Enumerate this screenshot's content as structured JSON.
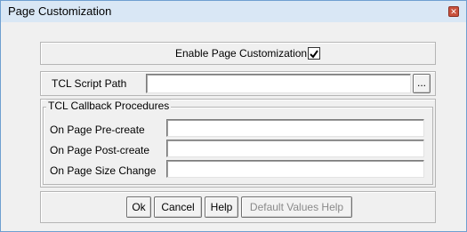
{
  "window": {
    "title": "Page Customization",
    "close_icon": "close-icon"
  },
  "enable": {
    "label": "Enable Page Customization",
    "checked": true
  },
  "script": {
    "label": "TCL Script Path",
    "value": "",
    "browse_label": "..."
  },
  "callbacks": {
    "group_title": "TCL Callback Procedures",
    "rows": [
      {
        "label": "On Page Pre-create",
        "value": ""
      },
      {
        "label": "On Page Post-create",
        "value": ""
      },
      {
        "label": "On Page Size Change",
        "value": ""
      }
    ]
  },
  "buttons": {
    "ok": "Ok",
    "cancel": "Cancel",
    "help": "Help",
    "default_help": "Default Values Help"
  }
}
